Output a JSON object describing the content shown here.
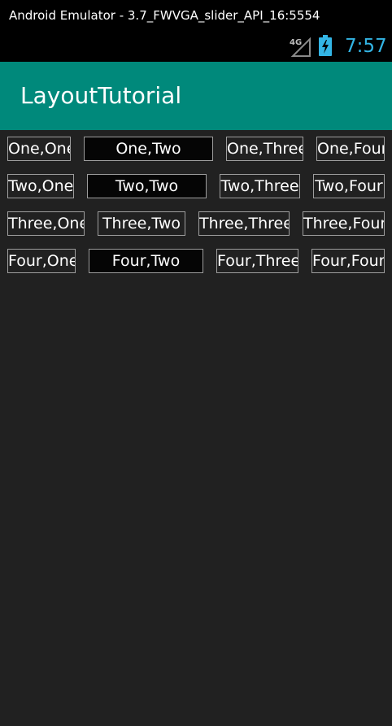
{
  "window": {
    "title": "Android Emulator - 3.7_FWVGA_slider_API_16:5554"
  },
  "status_bar": {
    "network_label": "4G",
    "time": "7:57",
    "icons": [
      "signal-4g-icon",
      "battery-charging-icon"
    ],
    "time_color": "#33b5e5"
  },
  "app_bar": {
    "title": "LayoutTutorial",
    "background": "#00897b"
  },
  "grid": {
    "rows": [
      [
        "One,One",
        "One,Two",
        "One,Three",
        "One,Four"
      ],
      [
        "Two,One",
        "Two,Two",
        "Two,Three",
        "Two,Four"
      ],
      [
        "Three,One",
        "Three,Two",
        "Three,Three",
        "Three,Four"
      ],
      [
        "Four,One",
        "Four,Two",
        "Four,Three",
        "Four,Four"
      ]
    ]
  }
}
